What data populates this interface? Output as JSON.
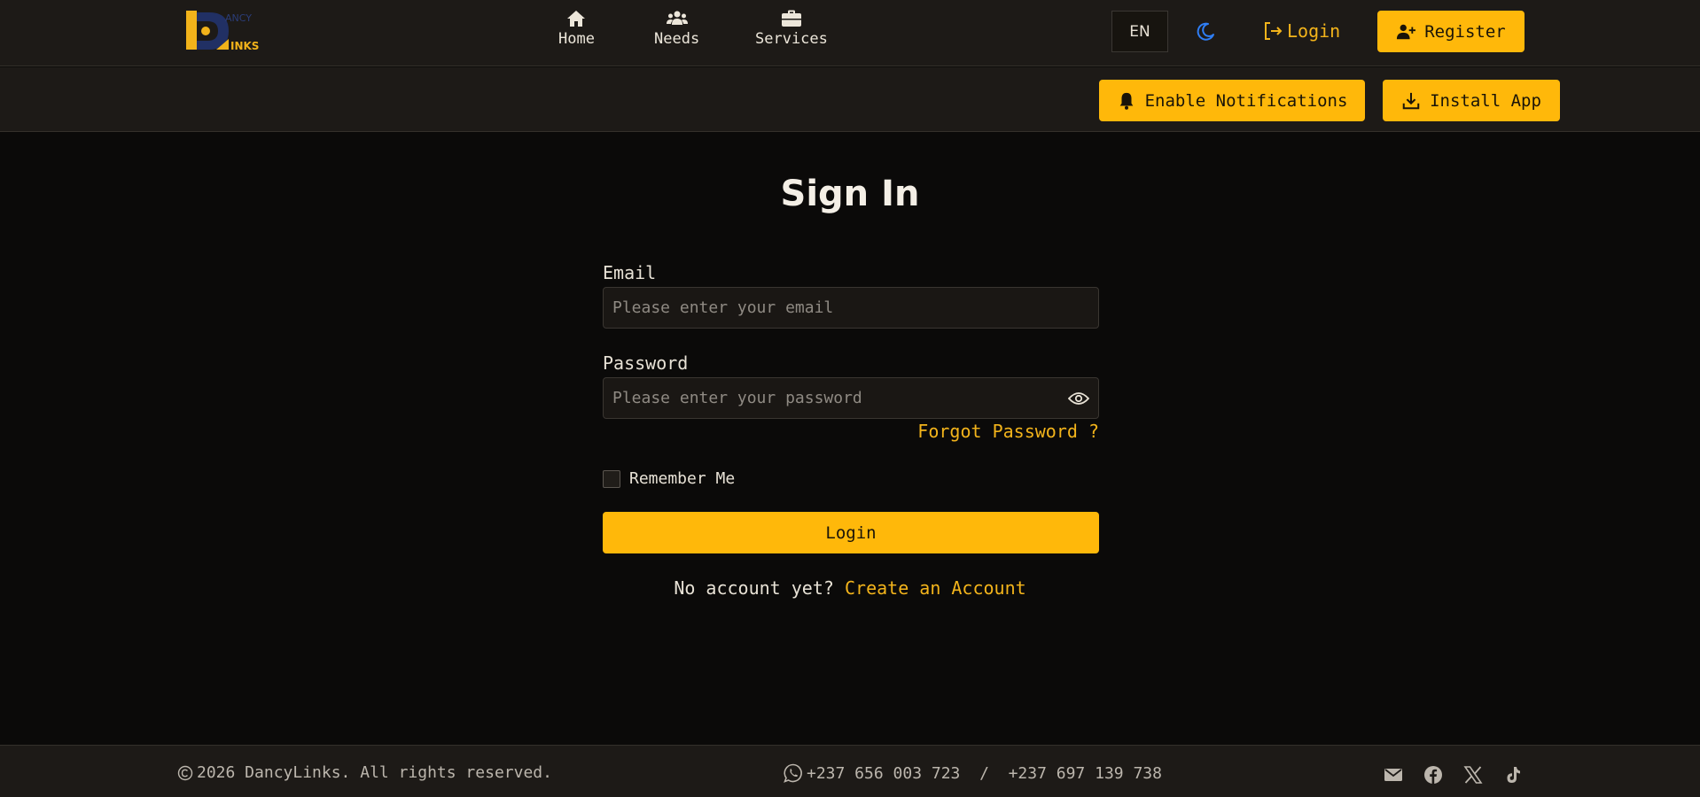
{
  "header": {
    "logo_alt": "DancyLinks",
    "nav": [
      {
        "label": "Home",
        "icon": "home-icon"
      },
      {
        "label": "Needs",
        "icon": "users-icon"
      },
      {
        "label": "Services",
        "icon": "briefcase-icon"
      }
    ],
    "language": "EN",
    "theme_icon": "moon-icon",
    "login_label": "Login",
    "register_label": "Register"
  },
  "subbar": {
    "notifications_label": "Enable Notifications",
    "install_label": "Install App"
  },
  "form": {
    "title": "Sign In",
    "email_label": "Email",
    "email_placeholder": "Please enter your email",
    "password_label": "Password",
    "password_placeholder": "Please enter your password",
    "forgot_label": "Forgot Password ?",
    "remember_label": "Remember Me",
    "submit_label": "Login",
    "no_account_text": "No account yet?",
    "create_account_label": "Create an Account"
  },
  "footer": {
    "copyright": "2026 DancyLinks. All rights reserved.",
    "phones": "+237 656 003 723  /  +237 697 139 738",
    "social_icons": [
      "mail-icon",
      "facebook-icon",
      "x-icon",
      "tiktok-icon"
    ]
  },
  "colors": {
    "accent": "#ffb80a",
    "background": "#0b0a09",
    "bar": "#1d1a17",
    "moon": "#2f7ef5"
  }
}
